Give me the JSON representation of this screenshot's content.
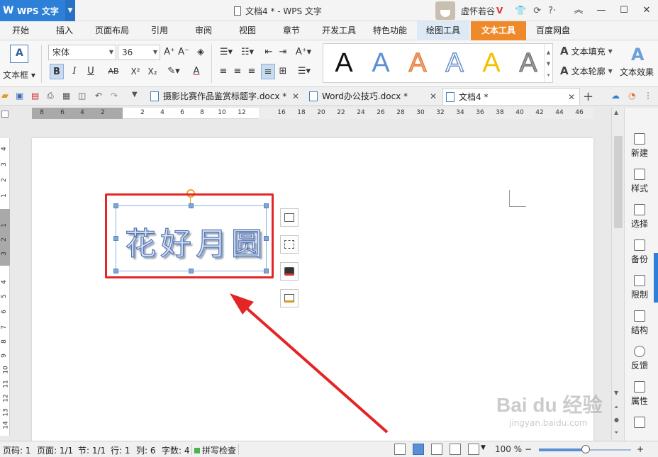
{
  "titlebar": {
    "app_name": "WPS 文字",
    "doc_title": "文档4 * - WPS 文字",
    "user_name": "虚怀若谷",
    "vip_badge": "V"
  },
  "menu_tabs": [
    "开始",
    "插入",
    "页面布局",
    "引用",
    "审阅",
    "视图",
    "章节",
    "开发工具",
    "特色功能",
    "绘图工具",
    "文本工具",
    "百度网盘"
  ],
  "active_tab": "文本工具",
  "ribbon": {
    "textbox_label": "文本框",
    "font_name": "宋体",
    "font_size": "36",
    "bold": "B",
    "italic": "I",
    "underline": "U",
    "strike": "AB",
    "superscript": "X²",
    "subscript": "X₂",
    "font_color": "A",
    "gallery_letter": "A",
    "text_fill": "文本填充",
    "text_outline": "文本轮廓",
    "text_effect": "文本效果"
  },
  "doc_tabs": [
    {
      "label": "摄影比赛作品鉴赏标题字.docx *"
    },
    {
      "label": "Word办公技巧.docx *"
    },
    {
      "label": "文档4 *"
    }
  ],
  "ruler_h": [
    "8",
    "6",
    "4",
    "2",
    "2",
    "4",
    "6",
    "8",
    "10",
    "12",
    "16",
    "18",
    "20",
    "22",
    "24",
    "26",
    "28",
    "30",
    "32",
    "34",
    "36",
    "38",
    "40",
    "42",
    "44",
    "46"
  ],
  "ruler_v": [
    "4",
    "3",
    "2",
    "1",
    "1",
    "2",
    "3",
    "4",
    "5",
    "6",
    "7",
    "8",
    "9",
    "10",
    "11",
    "12",
    "13",
    "14",
    "15"
  ],
  "document": {
    "art_text": "花好月圆"
  },
  "right_panel": [
    "新建",
    "样式",
    "选择",
    "备份",
    "限制",
    "结构",
    "反馈",
    "属性"
  ],
  "status": {
    "page_code": "页码: 1",
    "page": "页面: 1/1",
    "section": "节: 1/1",
    "row": "行: 1",
    "col": "列: 6",
    "word_count": "字数: 4",
    "spell": "拼写检查",
    "zoom": "100 %",
    "zoom_minus": "−",
    "zoom_plus": "+"
  },
  "watermark": {
    "brand": "Bai du 经验",
    "url": "jingyan.baidu.com"
  },
  "colors": {
    "accent": "#2d7fd8",
    "active_tab": "#ef8a2a",
    "highlight": "#e32525"
  }
}
